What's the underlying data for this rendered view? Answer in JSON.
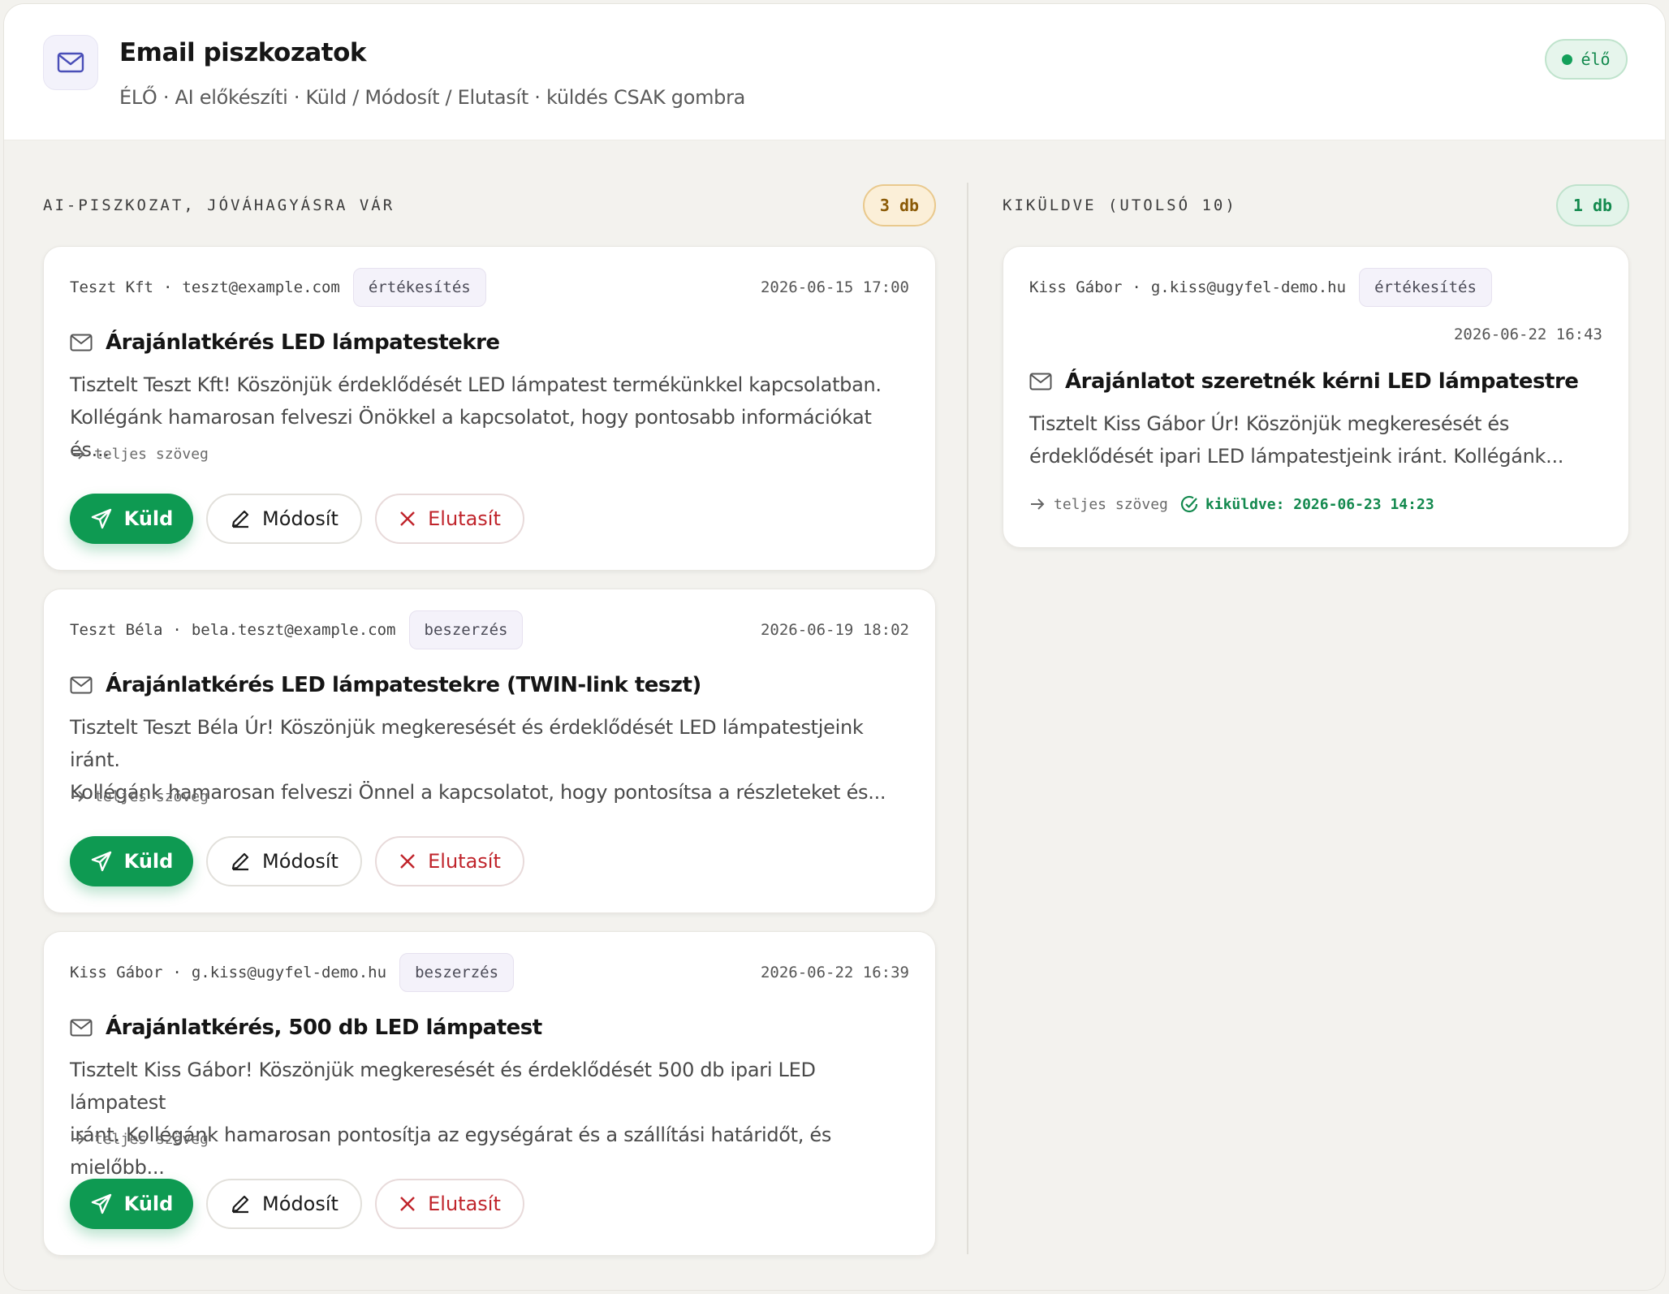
{
  "header": {
    "title": "Email piszkozatok",
    "subtitle": "ÉLŐ · AI előkészíti · Küld / Módosít / Elutasít · küldés CSAK gombra",
    "status": "élő",
    "icon": "mail-icon"
  },
  "pending": {
    "heading": "AI-PISZKOZAT, JÓVÁHAGYÁSRA VÁR",
    "count": "3 db",
    "drafts": [
      {
        "sender": "Teszt Kft",
        "email": "teszt@example.com",
        "tag": "értékesítés",
        "date": "2026-06-15 17:00",
        "subject": "Árajánlatkérés LED lámpatestekre",
        "body_line1": "Tisztelt Teszt Kft! Köszönjük érdeklődését LED lámpatest termékünkkel kapcsolatban.",
        "body_line2": "Kollégánk hamarosan felveszi Önökkel a kapcsolatot, hogy pontosabb információkat és...",
        "link": "teljes szöveg",
        "send": "Küld",
        "edit": "Módosít",
        "reject": "Elutasít"
      },
      {
        "sender": "Teszt Béla",
        "email": "bela.teszt@example.com",
        "tag": "beszerzés",
        "date": "2026-06-19 18:02",
        "subject": "Árajánlatkérés LED lámpatestekre (TWIN-link teszt)",
        "body_line1": "Tisztelt Teszt Béla Úr! Köszönjük megkeresését és érdeklődését LED lámpatestjeink iránt.",
        "body_line2": "Kollégánk hamarosan felveszi Önnel a kapcsolatot, hogy pontosítsa a részleteket és...",
        "link": "teljes szöveg",
        "send": "Küld",
        "edit": "Módosít",
        "reject": "Elutasít"
      },
      {
        "sender": "Kiss Gábor",
        "email": "g.kiss@ugyfel-demo.hu",
        "tag": "beszerzés",
        "date": "2026-06-22 16:39",
        "subject": "Árajánlatkérés, 500 db LED lámpatest",
        "body_line1": "Tisztelt Kiss Gábor! Köszönjük megkeresését és érdeklődését 500 db ipari LED lámpatest",
        "body_line2": "iránt. Kollégánk hamarosan pontosítja az egységárat és a szállítási határidőt, és mielőbb...",
        "link": "teljes szöveg",
        "send": "Küld",
        "edit": "Módosít",
        "reject": "Elutasít"
      }
    ]
  },
  "sent": {
    "heading": "KIKÜLDVE (UTOLSÓ 10)",
    "count": "1 db",
    "items": [
      {
        "sender": "Kiss Gábor",
        "email": "g.kiss@ugyfel-demo.hu",
        "tag": "értékesítés",
        "date": "2026-06-22 16:43",
        "subject": "Árajánlatot szeretnék kérni LED lámpatestre",
        "body_line1": "Tisztelt Kiss Gábor Úr! Köszönjük megkeresését és",
        "body_line2": "érdeklődését ipari LED lámpatestjeink iránt. Kollégánk...",
        "link": "teljes szöveg",
        "sent_status": "kiküldve: 2026-06-23 14:23"
      }
    ]
  },
  "colors": {
    "accent_green": "#0e9a52",
    "reject_red": "#c0242b",
    "pending_badge": "#fbefd8",
    "sent_badge": "#e3f4ea"
  }
}
